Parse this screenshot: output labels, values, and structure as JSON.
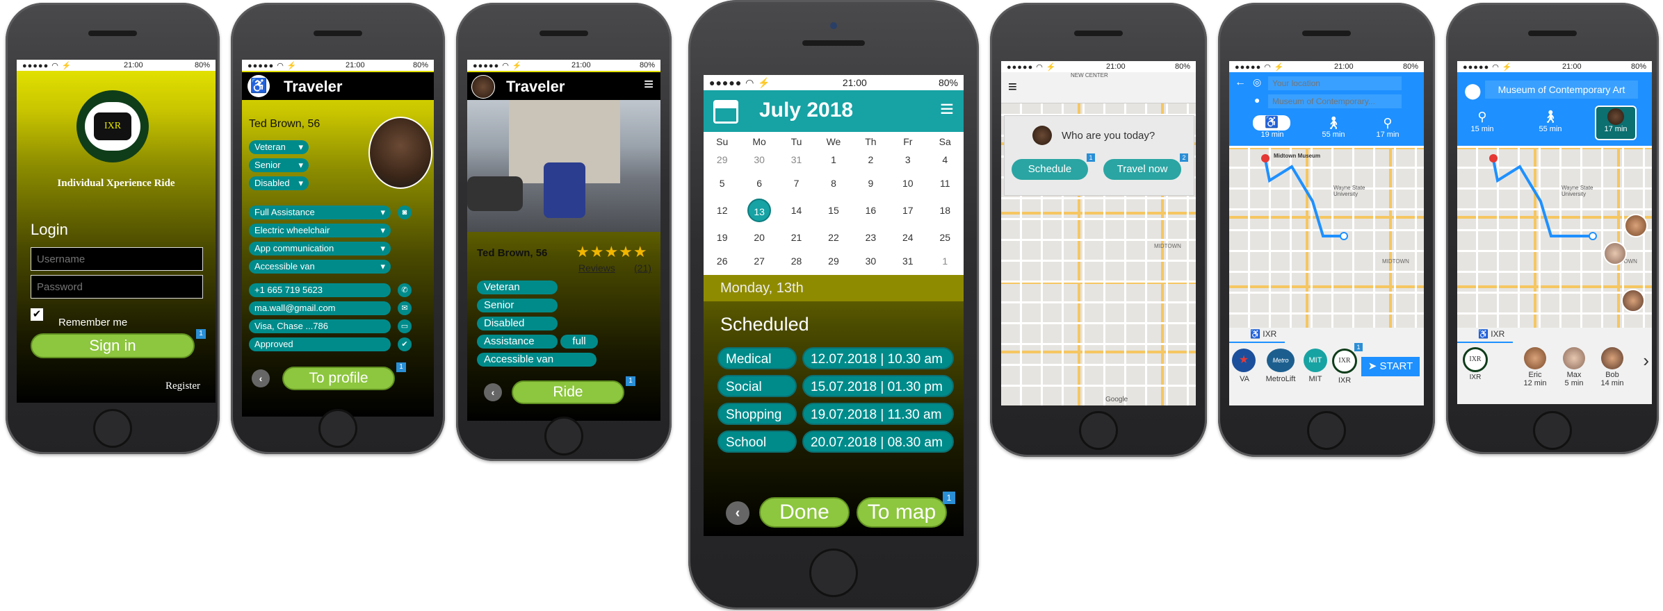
{
  "status": {
    "time": "21:00",
    "battery": "80%",
    "dots": "●●●●● ◠ ⚡"
  },
  "p1": {
    "logo_text": "IXR",
    "app_name": "Individual Xperience Ride",
    "login_title": "Login",
    "username_placeholder": "Username",
    "password_placeholder": "Password",
    "remember": "Remember me",
    "signin": "Sign in",
    "badge": "1",
    "register": "Register"
  },
  "p2": {
    "title": "Traveler",
    "name": "Ted Brown, 56",
    "tags": [
      "Veteran",
      "Senior",
      "Disabled"
    ],
    "options": [
      "Full Assistance",
      "Electric wheelchair",
      "App communication",
      "Accessible van"
    ],
    "fields": [
      "+1 665 719 5623",
      "ma.wall@gmail.com",
      "Visa, Chase ...786",
      "Approved"
    ],
    "button": "To profile",
    "badge": "1"
  },
  "p3": {
    "title": "Traveler",
    "name": "Ted Brown, 56",
    "stars": "★★★★★",
    "reviews": "Reviews",
    "reviews_count": "(21)",
    "tags": [
      "Veteran",
      "Senior",
      "Disabled",
      "Assistance",
      "Accessible van"
    ],
    "assist_level": "full",
    "button": "Ride",
    "badge": "1"
  },
  "p4": {
    "month": "July 2018",
    "weekdays": [
      "Su",
      "Mo",
      "Tu",
      "We",
      "Th",
      "Fr",
      "Sa"
    ],
    "weeks": [
      [
        "29",
        "30",
        "31",
        "1",
        "2",
        "3",
        "4"
      ],
      [
        "5",
        "6",
        "7",
        "8",
        "9",
        "10",
        "11"
      ],
      [
        "12",
        "13",
        "14",
        "15",
        "16",
        "17",
        "18"
      ],
      [
        "19",
        "20",
        "21",
        "22",
        "23",
        "24",
        "25"
      ],
      [
        "26",
        "27",
        "28",
        "29",
        "30",
        "31",
        "1"
      ]
    ],
    "selected_day": "13",
    "day_label": "Monday, 13th",
    "section": "Scheduled",
    "rides": [
      {
        "type": "Medical",
        "when": "12.07.2018 | 10.30 am"
      },
      {
        "type": "Social",
        "when": "15.07.2018 | 01.30 pm"
      },
      {
        "type": "Shopping",
        "when": "19.07.2018 | 11.30 am"
      },
      {
        "type": "School",
        "when": "20.07.2018 | 08.30 am"
      }
    ],
    "done": "Done",
    "to_map": "To map",
    "badge": "1"
  },
  "p5": {
    "prompt": "Who are you today?",
    "schedule": "Schedule",
    "travel_now": "Travel now",
    "badge1": "1",
    "badge2": "2",
    "map_labels": [
      "NEW CENTER",
      "MIDTOWN",
      "Google"
    ]
  },
  "p6": {
    "loc_placeholder": "Your location",
    "dest_placeholder": "Museum of Contemporary...",
    "modes": [
      {
        "icon": "wheelchair-icon",
        "time": "19 min"
      },
      {
        "icon": "walk-icon",
        "time": "55 min"
      },
      {
        "icon": "cane-icon",
        "time": "17 min"
      }
    ],
    "tab_label": "IXR",
    "providers": [
      "VA",
      "MetroLift",
      "MIT",
      "IXR"
    ],
    "start": "START",
    "badge": "1",
    "map_labels": [
      "Midtown Museum",
      "Wayne State University",
      "MIDTOWN"
    ]
  },
  "p7": {
    "destination": "Museum of Contemporary Art",
    "modes": [
      {
        "time": "15 min"
      },
      {
        "time": "55 min"
      },
      {
        "time": "17 min"
      }
    ],
    "tab_label": "IXR",
    "drivers": [
      {
        "name": "IXR",
        "time": ""
      },
      {
        "name": "Eric",
        "time": "12 min"
      },
      {
        "name": "Max",
        "time": "5 min"
      },
      {
        "name": "Bob",
        "time": "14 min"
      }
    ],
    "map_labels": [
      "Wayne State University",
      "MIDTOWN"
    ]
  }
}
